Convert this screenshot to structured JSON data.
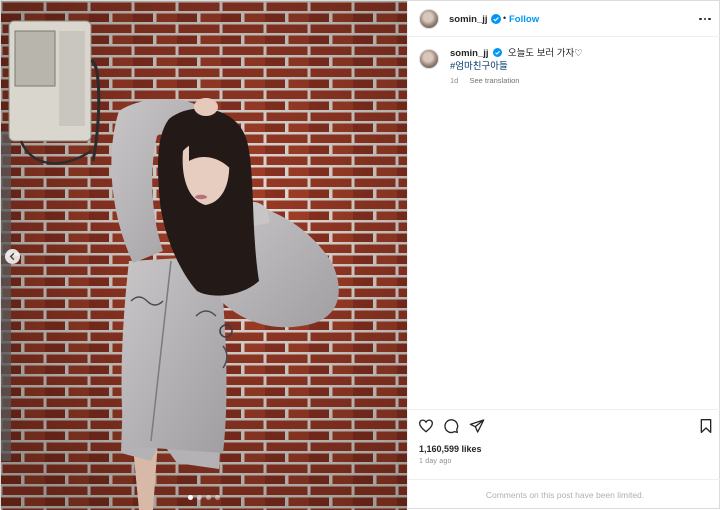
{
  "post": {
    "username": "somin_jj",
    "follow_label": "Follow",
    "separator": "•",
    "caption_text": "오늘도 보러 가자♡",
    "hashtag": "#엄마친구아들",
    "caption_age": "1d",
    "see_translation_label": "See translation",
    "likes_label": "1,160,599 likes",
    "time_ago_label": "1 day ago",
    "comments_limited_label": "Comments on this post have been limited.",
    "carousel": {
      "slide_count": 4,
      "active_index": 0
    }
  },
  "icons": {
    "verified": "verified-badge-icon",
    "more": "more-options-icon",
    "like": "heart-icon",
    "comment": "comment-icon",
    "share": "paper-plane-icon",
    "save": "bookmark-icon",
    "prev": "chevron-left-icon"
  },
  "colors": {
    "accent": "#0095f6",
    "verified": "#0095f6",
    "hashtag": "#00376b",
    "muted": "#8e8e8e",
    "text": "#262626"
  }
}
